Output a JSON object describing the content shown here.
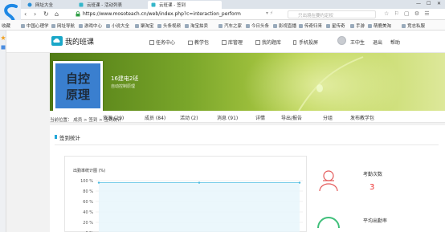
{
  "browser": {
    "tabs": [
      {
        "title": "网址大全",
        "active": false
      },
      {
        "title": "云班课 - 活动列表",
        "active": false
      },
      {
        "title": "云班课 - 签到",
        "active": true
      }
    ],
    "url": "https://www.mosoteach.cn/web/index.php?c=interaction_perform",
    "search_placeholder": "只出境在要约定权",
    "bookmarks": [
      "收藏",
      "中国心理学",
      "网址导航",
      "游戏中心",
      "小说大全",
      "聚淘宝",
      "头条视频",
      "淘宝拍卖",
      "汽车之家",
      "今日头条",
      "影视直播",
      "传奇归来",
      "星传奇",
      "手游",
      "萌鹿美淘",
      "竞志私服"
    ]
  },
  "site": {
    "name": "我的班课",
    "nav": [
      {
        "label": "任务中心",
        "icon": "clipboard-icon"
      },
      {
        "label": "教学包",
        "icon": "package-icon"
      },
      {
        "label": "库管理",
        "icon": "library-icon"
      },
      {
        "label": "我的题库",
        "icon": "question-bank-icon"
      },
      {
        "label": "手机投屏",
        "icon": "phone-icon"
      }
    ],
    "user_name": "王中生",
    "logout": "退出",
    "help": "帮助"
  },
  "course": {
    "cover_line1": "自控",
    "cover_line2": "原理",
    "class_name": "16建电2班",
    "class_sub": "自动控制原理",
    "accent": "#3a7fcf"
  },
  "course_tabs": [
    "资源 (29)",
    "成员 (84)",
    "活动 (2)",
    "消息 (91)",
    "详情",
    "导出/报告",
    "分组",
    "发布教学包"
  ],
  "breadcrumb": "当前位置： 成员 > 签到 > 签到统计",
  "panel": {
    "title": "签到统计",
    "chart_label": "出勤率统计图 (%)",
    "attendance_count_label": "考勤次数",
    "attendance_count_value": "3",
    "avg_rate_label": "平均出勤率"
  },
  "chart_data": {
    "type": "line",
    "title": "出勤率统计图 (%)",
    "ytick_labels": [
      "100 %",
      "80 %",
      "60 %",
      "40 %",
      "20 %",
      "0 %"
    ],
    "ylim": [
      0,
      100
    ],
    "values": [
      96,
      96,
      96
    ],
    "series_color": "#4bbbe0",
    "grid": true
  }
}
